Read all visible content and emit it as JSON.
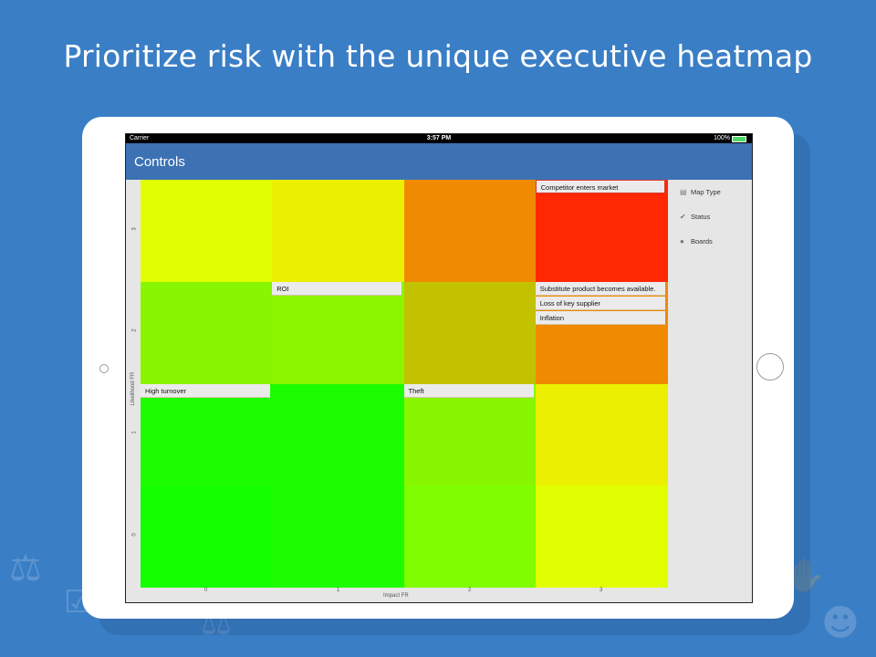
{
  "headline": "Prioritize risk with the unique executive heatmap",
  "status_bar": {
    "carrier": "Carrier",
    "time": "3:57 PM",
    "battery": "100%"
  },
  "nav": {
    "title": "Controls"
  },
  "side_menu": [
    {
      "label": "Map Type",
      "icon": "map-type-icon"
    },
    {
      "label": "Status",
      "icon": "checkmark-icon"
    },
    {
      "label": "Boards",
      "icon": "person-icon"
    }
  ],
  "axes": {
    "ylabel": "Likelihood FR",
    "xlabel": "Impact FR",
    "x_ticks": [
      "0",
      "1",
      "2",
      "3"
    ],
    "y_ticks": [
      "3",
      "2",
      "1",
      "0"
    ]
  },
  "chart_data": {
    "type": "heatmap",
    "xlabel": "Impact FR",
    "ylabel": "Likelihood FR",
    "x_categories": [
      "0",
      "1",
      "2",
      "3"
    ],
    "y_categories": [
      "0",
      "1",
      "2",
      "3"
    ],
    "colors": [
      [
        "#e1ff00",
        "#eaf000",
        "#f08a00",
        "#ff2800"
      ],
      [
        "#88f600",
        "#8cf500",
        "#c2c200",
        "#f08a00"
      ],
      [
        "#1cfd00",
        "#1cfd00",
        "#88f600",
        "#eaf000"
      ],
      [
        "#14ff00",
        "#1cfd00",
        "#80fd00",
        "#e1ff00"
      ]
    ],
    "risks": [
      {
        "impact": 3,
        "likelihood": 3,
        "label": "Competitor enters market"
      },
      {
        "impact": 1,
        "likelihood": 2,
        "label": "ROI"
      },
      {
        "impact": 3,
        "likelihood": 2,
        "label": "Substitute product becomes available."
      },
      {
        "impact": 3,
        "likelihood": 2,
        "label": "Loss of key supplier"
      },
      {
        "impact": 3,
        "likelihood": 2,
        "label": "Inflation"
      },
      {
        "impact": 0,
        "likelihood": 1,
        "label": "High turnover"
      },
      {
        "impact": 2,
        "likelihood": 1,
        "label": "Theft"
      }
    ]
  }
}
